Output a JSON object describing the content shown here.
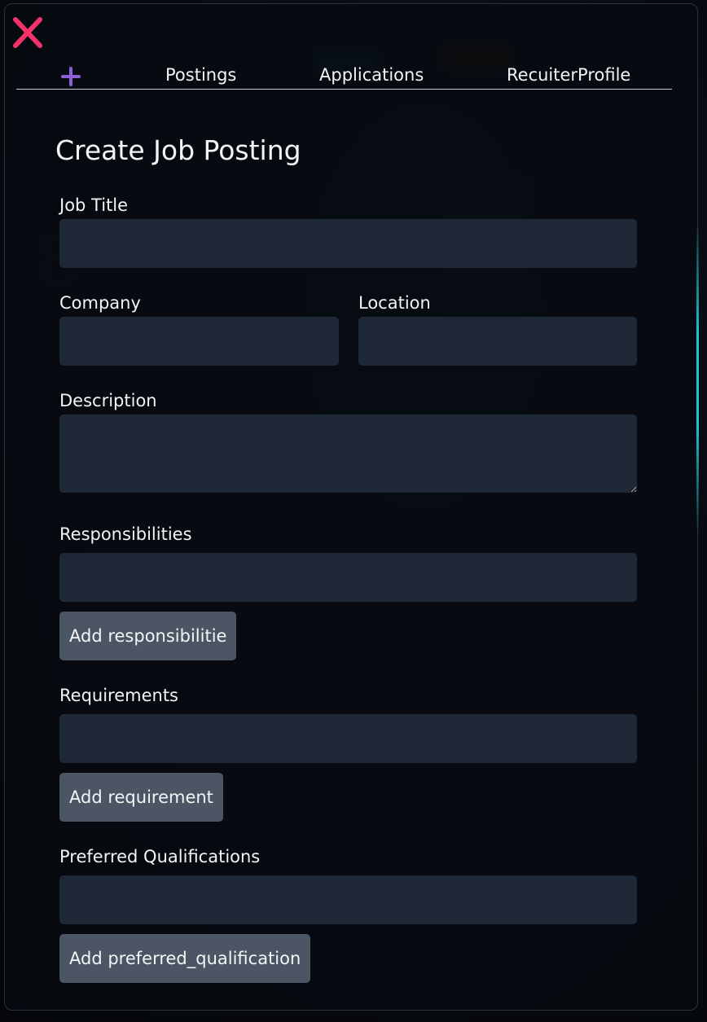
{
  "nav": {
    "add_icon": "plus-icon",
    "tabs": [
      "Postings",
      "Applications",
      "RecuiterProfile"
    ]
  },
  "close_icon": "close-icon",
  "form": {
    "title": "Create Job Posting",
    "job_title_label": "Job Title",
    "job_title_value": "",
    "company_label": "Company",
    "company_value": "",
    "location_label": "Location",
    "location_value": "",
    "description_label": "Description",
    "description_value": "",
    "responsibilities_label": "Responsibilities",
    "responsibilities_value": "",
    "add_responsibility_label": "Add responsibilitie",
    "requirements_label": "Requirements",
    "requirements_value": "",
    "add_requirement_label": "Add requirement",
    "preferred_label": "Preferred Qualifications",
    "preferred_value": "",
    "add_preferred_label": "Add preferred_qualification"
  },
  "colors": {
    "close": "#f0346a",
    "plus": "#8b5fd6",
    "input_bg": "#1e2836",
    "button_bg": "#4b5563",
    "scroll_accent": "#17c7d4"
  }
}
